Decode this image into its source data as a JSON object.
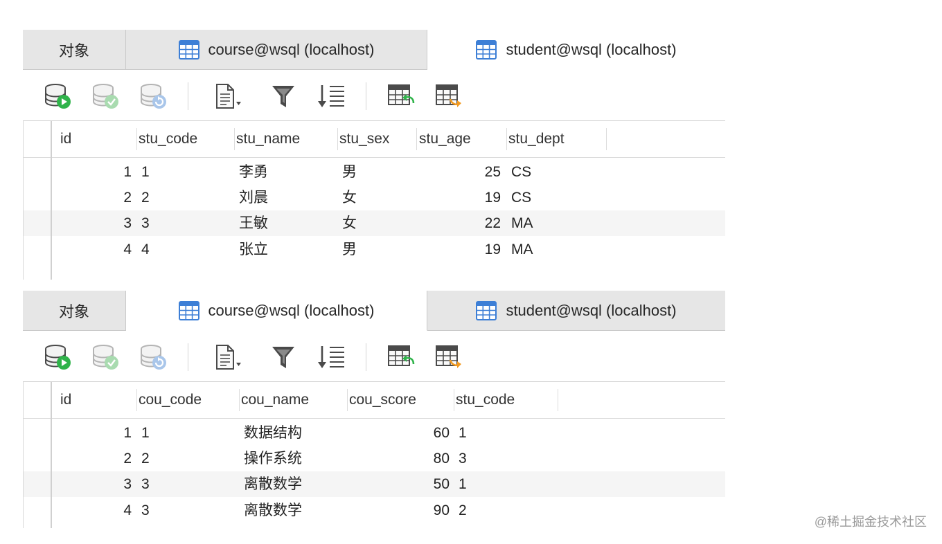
{
  "panels": [
    {
      "tabs": {
        "objects": "对象",
        "tab1": "course@wsql (localhost)",
        "tab2": "student@wsql (localhost)",
        "active": "tab2"
      },
      "columns": [
        "id",
        "stu_code",
        "stu_name",
        "stu_sex",
        "stu_age",
        "stu_dept"
      ],
      "rows": [
        [
          "1",
          "1",
          "李勇",
          "男",
          "25",
          "CS"
        ],
        [
          "2",
          "2",
          "刘晨",
          "女",
          "19",
          "CS"
        ],
        [
          "3",
          "3",
          "王敏",
          "女",
          "22",
          "MA"
        ],
        [
          "4",
          "4",
          "张立",
          "男",
          "19",
          "MA"
        ]
      ]
    },
    {
      "tabs": {
        "objects": "对象",
        "tab1": "course@wsql (localhost)",
        "tab2": "student@wsql (localhost)",
        "active": "tab1"
      },
      "columns": [
        "id",
        "cou_code",
        "cou_name",
        "cou_score",
        "stu_code"
      ],
      "rows": [
        [
          "1",
          "1",
          "数据结构",
          "60",
          "1"
        ],
        [
          "2",
          "2",
          "操作系统",
          "80",
          "3"
        ],
        [
          "3",
          "3",
          "离散数学",
          "50",
          "1"
        ],
        [
          "4",
          "3",
          "离散数学",
          "90",
          "2"
        ]
      ]
    }
  ],
  "toolbar_icons": [
    "begin-transaction-icon",
    "commit-icon",
    "rollback-icon",
    "text-view-icon",
    "filter-icon",
    "sort-icon",
    "import-icon",
    "export-icon"
  ],
  "colors": {
    "tab_active": "#ffffff",
    "tab_inactive": "#e6e6e6",
    "row_alt": "#f5f5f5",
    "table_icon": "#3d7fd6",
    "run_green": "#2fb34a"
  },
  "watermark": "@稀土掘金技术社区"
}
